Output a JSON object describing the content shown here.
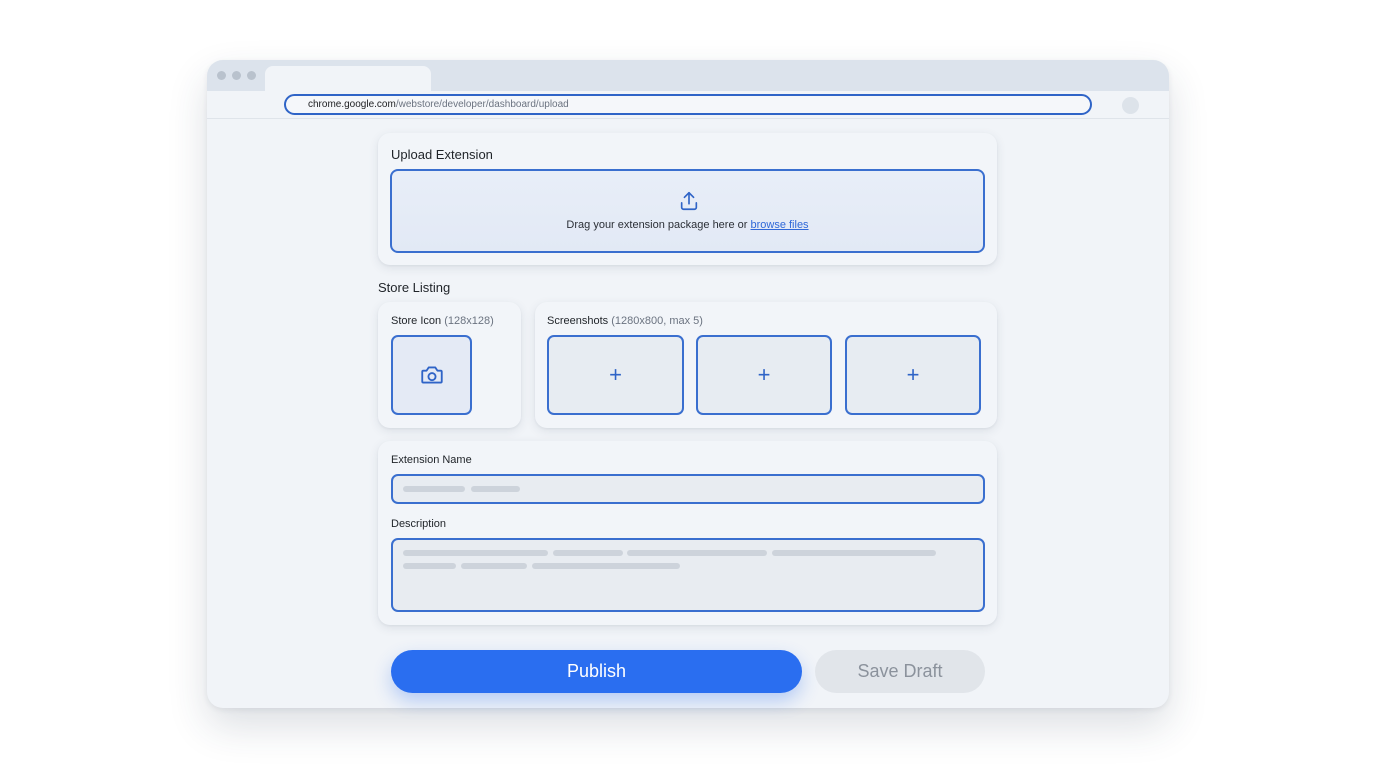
{
  "browser": {
    "url_host": "chrome.google.com",
    "url_path": "/webstore/developer/dashboard/upload"
  },
  "upload": {
    "title": "Upload Extension",
    "hint_text": "Drag your extension package here or ",
    "browse_link": "browse files"
  },
  "store_listing": {
    "heading": "Store Listing",
    "icon_label": "Store Icon",
    "icon_size": "(128x128)",
    "screenshots_label": "Screenshots",
    "screenshots_spec": "(1280x800, max 5)",
    "slot_symbol": "+"
  },
  "details": {
    "name_label": "Extension Name",
    "description_label": "Description"
  },
  "actions": {
    "publish": "Publish",
    "save_draft": "Save Draft"
  },
  "colors": {
    "accent": "#2a6ef0",
    "border_blue": "#3a6fcf",
    "window_bg": "#f1f4f8",
    "secondary_button": "#e1e5ea"
  }
}
